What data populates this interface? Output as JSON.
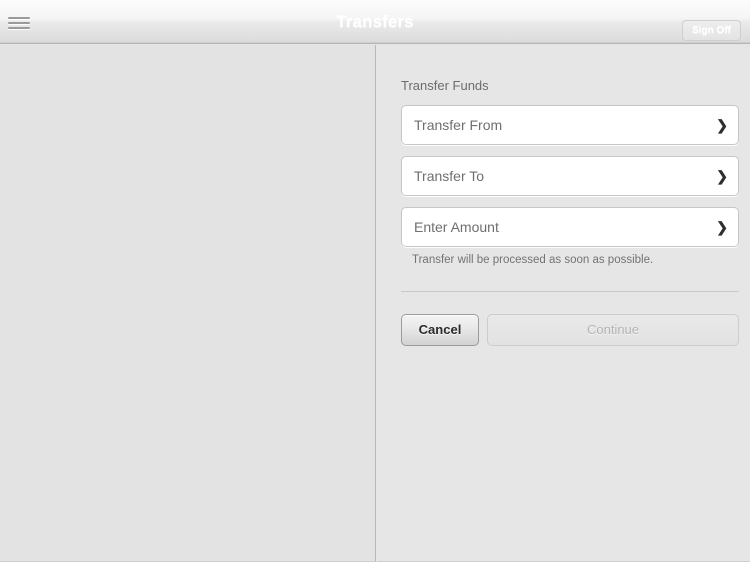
{
  "navbar": {
    "title": "Transfers",
    "menu_icon": "hamburger-menu-icon",
    "signoff_label": "Sign Off"
  },
  "panel": {
    "section_title": "Transfer Funds",
    "rows": [
      {
        "label": "Transfer From",
        "icon": "chevron-right-icon",
        "value": ""
      },
      {
        "label": "Transfer To",
        "icon": "chevron-right-icon",
        "value": ""
      },
      {
        "label": "Enter Amount",
        "icon": "chevron-right-icon",
        "value": ""
      }
    ],
    "helper_text": "Transfer will be processed as soon as possible.",
    "actions": {
      "cancel_label": "Cancel",
      "continue_label": "Continue",
      "continue_disabled": true
    }
  },
  "colors": {
    "page_background": "#e5e5e5",
    "panel_background": "#e6e6e6",
    "row_background": "#ffffff",
    "row_border": "#c6c6c6",
    "label_text": "#6f6f6f",
    "title_text": "#ffffff",
    "chevron": "#2e2e2e",
    "divider": "#c9c9c9",
    "disabled_text": "#b4b4b4"
  }
}
